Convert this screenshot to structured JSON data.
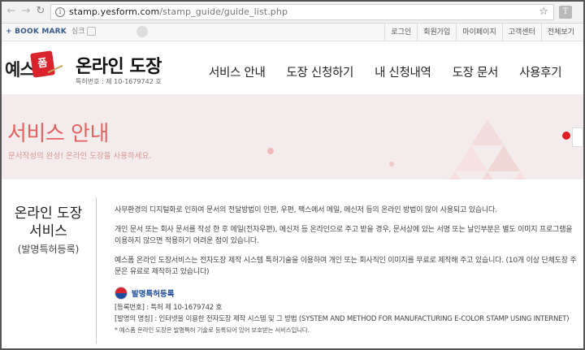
{
  "browser": {
    "url_host": "stamp.yesform.com",
    "url_path": "/stamp_guide/guide_list.php",
    "ext_label": "T"
  },
  "util_bar": {
    "bookmark": "+ BOOK MARK",
    "partner1": "싱크",
    "partner2": "",
    "links": [
      "로그인",
      "회원가입",
      "마이페이지",
      "고객센터",
      "전체보기"
    ]
  },
  "header": {
    "logo_ye": "예스",
    "logo_pom": "폼",
    "title": "온라인 도장",
    "patent_no": "특허번호 : 제 10-1679742 호",
    "nav": [
      "서비스 안내",
      "도장 신청하기",
      "내 신청내역",
      "도장 문서",
      "사용후기"
    ]
  },
  "hero": {
    "title": "서비스 안내",
    "subtitle": "문서작성의 완성! 온라인 도장을 사용하세요.",
    "accent": "#e56262"
  },
  "content": {
    "heading_line1": "온라인 도장",
    "heading_line2": "서비스",
    "heading_sub": "(발명특허등록)",
    "paragraphs": [
      "사무환경의 디지털화로 인하여 문서의 전달방법이 인편, 우편, 팩스에서 메일, 메신저 등의 온라인 방법이 많이 사용되고 있습니다.",
      "개인 문서 또는 회사 문서를 작성 한 후 메일(전자우편), 메신저 등 온라인으로 주고 받을 경우, 문서상에 있는 서명 또는 날인부분은 별도 이미지 프로그램을 이용하지 않으면 적용하기 어려운 점이 있습니다.",
      "예스폼 온라인 도장서비스는 전자도장 제작 시스템 특허기술을 이용하여 개인 또는 회사직인 이미지를 무료로 제작해 주고 있습니다. (10개 이상 단체도장 주문은 유료로 제작하고 있습니다)"
    ],
    "badge_label": "발명특허등록",
    "reg_no": "[등록번호] : 특허 제 10-1679742 호",
    "invention_name": "[발명의 명칭] : 인터넷을 이용한 전자도장 제작 시스템 및 그 방법 (SYSTEM AND METHOD FOR MANUFACTURING E-COLOR STAMP USING INTERNET)",
    "note": "* 예스폼 온라인 도장은 발명특허 기술로 등록되어 있어 보호받는 서비스입니다."
  }
}
